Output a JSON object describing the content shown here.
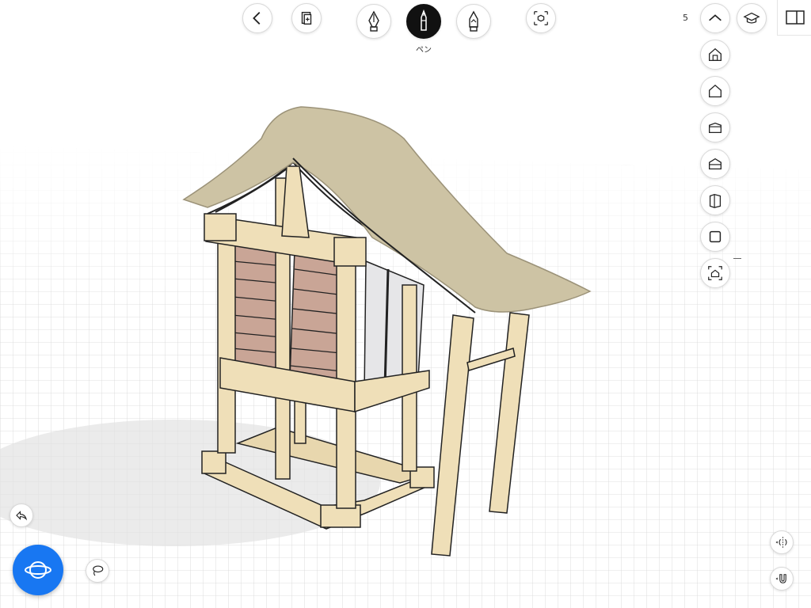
{
  "toolbar": {
    "active_tool_label": "ペン",
    "tools": [
      {
        "name": "fountain-pen",
        "active": false
      },
      {
        "name": "pen",
        "active": true
      },
      {
        "name": "marker",
        "active": false
      }
    ]
  },
  "right_panel": {
    "layer_count": "5",
    "view_icons": [
      "home-front-view",
      "home-outline-view",
      "box-top-view",
      "box-bottom-view",
      "box-side-view",
      "box-solid-view",
      "home-frame-view"
    ]
  },
  "icons": {
    "back": "chevron-left-icon",
    "pages": "document-add-icon",
    "transform": "cube-arrows-icon",
    "collapse": "chevron-up-icon",
    "learn": "graduation-cap-icon",
    "panel": "sidebar-toggle-icon",
    "undo": "undo-arrow-icon",
    "lasso": "lasso-icon",
    "orbit": "orbit-icon",
    "symmetry": "symmetry-icon",
    "magnet": "magnet-icon"
  },
  "colors": {
    "accent": "#1877f2",
    "roof": "#cdc3a4",
    "timber": "#efdfb8",
    "wall_panel": "#c9a596"
  }
}
